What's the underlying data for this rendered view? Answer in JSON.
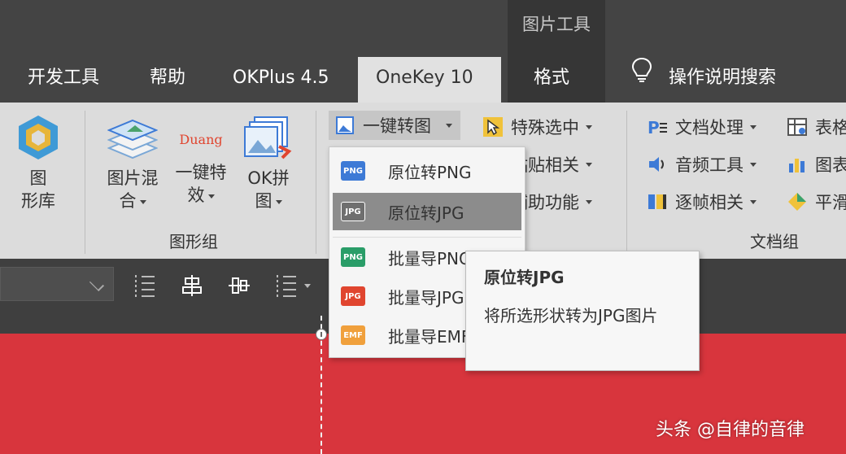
{
  "contextual_group": {
    "title": "图片工具"
  },
  "tabs": [
    {
      "label": "开发工具"
    },
    {
      "label": "帮助"
    },
    {
      "label": "OKPlus 4.5"
    },
    {
      "label": "OneKey 10",
      "active": true
    },
    {
      "label": "格式"
    },
    {
      "label": "操作说明搜索",
      "icon": "lightbulb-icon"
    }
  ],
  "ribbon": {
    "image_library": {
      "label_line1": "图",
      "label_line2": "形库"
    },
    "image_mix": {
      "label_line1": "图片混",
      "label_line2": "合"
    },
    "one_click_effect": {
      "label_line1": "一键特",
      "label_line2": "效",
      "icon_text": "Duang"
    },
    "ok_collage": {
      "label_line1": "OK拼",
      "label_line2": "图"
    },
    "graphics_group_label": "图形组",
    "one_click_convert": {
      "label": "一键转图"
    },
    "special_select": {
      "label": "特殊选中"
    },
    "paste_related": {
      "label": "粘贴相关"
    },
    "assist_functions": {
      "label": "辅助功能"
    },
    "doc_processing": {
      "label": "文档处理"
    },
    "audio_tools": {
      "label": "音频工具"
    },
    "frame_related": {
      "label": "逐帧相关"
    },
    "table": {
      "label": "表格"
    },
    "chart": {
      "label": "图表"
    },
    "smooth": {
      "label": "平滑"
    },
    "document_group_label": "文档组"
  },
  "convert_menu": {
    "items": [
      {
        "label": "原位转PNG",
        "badge": "PNG",
        "color": "#3d7ad6"
      },
      {
        "label": "原位转JPG",
        "badge": "JPG",
        "color": "#6f6f6f",
        "highlighted": true
      },
      {
        "label": "批量导PNG",
        "badge": "PNG",
        "color": "#2a9d68"
      },
      {
        "label": "批量导JPG",
        "badge": "JPG",
        "color": "#e0452f"
      },
      {
        "label": "批量导EMF",
        "badge": "EMF",
        "color": "#f0a03c"
      }
    ]
  },
  "tooltip": {
    "title": "原位转JPG",
    "body": "将所选形状转为JPG图片"
  },
  "watermark": "头条 @自律的音律"
}
